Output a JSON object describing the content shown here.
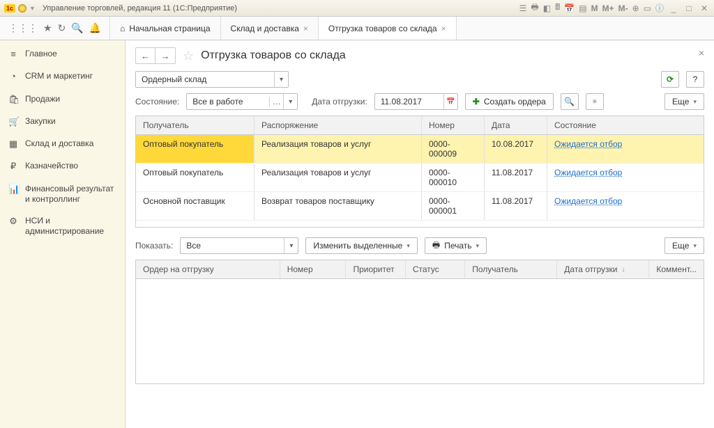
{
  "window": {
    "title": "Управление торговлей, редакция 11 (1С:Предприятие)"
  },
  "toolbar_letters": {
    "m": "M",
    "mp": "M+",
    "mm": "M-"
  },
  "tabs": {
    "home": "Начальная страница",
    "t1": "Склад и доставка",
    "t2": "Отгрузка товаров со склада"
  },
  "sidebar": [
    {
      "icon": "≡",
      "label": "Главное"
    },
    {
      "icon": "◔",
      "label": "CRM и маркетинг"
    },
    {
      "icon": "🛍",
      "label": "Продажи"
    },
    {
      "icon": "🛒",
      "label": "Закупки"
    },
    {
      "icon": "▦",
      "label": "Склад и доставка"
    },
    {
      "icon": "₽",
      "label": "Казначейство"
    },
    {
      "icon": "📊",
      "label": "Финансовый результат и контроллинг"
    },
    {
      "icon": "⚙",
      "label": "НСИ и администрирование"
    }
  ],
  "page": {
    "title": "Отгрузка товаров со склада",
    "warehouse": "Ордерный склад",
    "state_label": "Состояние:",
    "state_value": "Все в работе",
    "date_label": "Дата отгрузки:",
    "date_value": "11.08.2017",
    "create_orders": "Создать ордера",
    "more": "Еще"
  },
  "grid1": {
    "headers": {
      "recipient": "Получатель",
      "order": "Распоряжение",
      "number": "Номер",
      "date": "Дата",
      "state": "Состояние"
    },
    "rows": [
      {
        "recipient": "Оптовый покупатель",
        "order": "Реализация товаров и услуг",
        "number": "0000-000009",
        "date": "10.08.2017",
        "state": "Ожидается отбор",
        "selected": true
      },
      {
        "recipient": "Оптовый покупатель",
        "order": "Реализация товаров и услуг",
        "number": "0000-000010",
        "date": "11.08.2017",
        "state": "Ожидается отбор"
      },
      {
        "recipient": "Основной поставщик",
        "order": "Возврат товаров поставщику",
        "number": "0000-000001",
        "date": "11.08.2017",
        "state": "Ожидается отбор"
      }
    ]
  },
  "panel2": {
    "show_label": "Показать:",
    "show_value": "Все",
    "change_selected": "Изменить выделенные",
    "print": "Печать"
  },
  "grid2": {
    "headers": {
      "order": "Ордер на отгрузку",
      "number": "Номер",
      "priority": "Приоритет",
      "status": "Статус",
      "recipient": "Получатель",
      "ship_date": "Дата отгрузки",
      "comment": "Коммент..."
    }
  }
}
